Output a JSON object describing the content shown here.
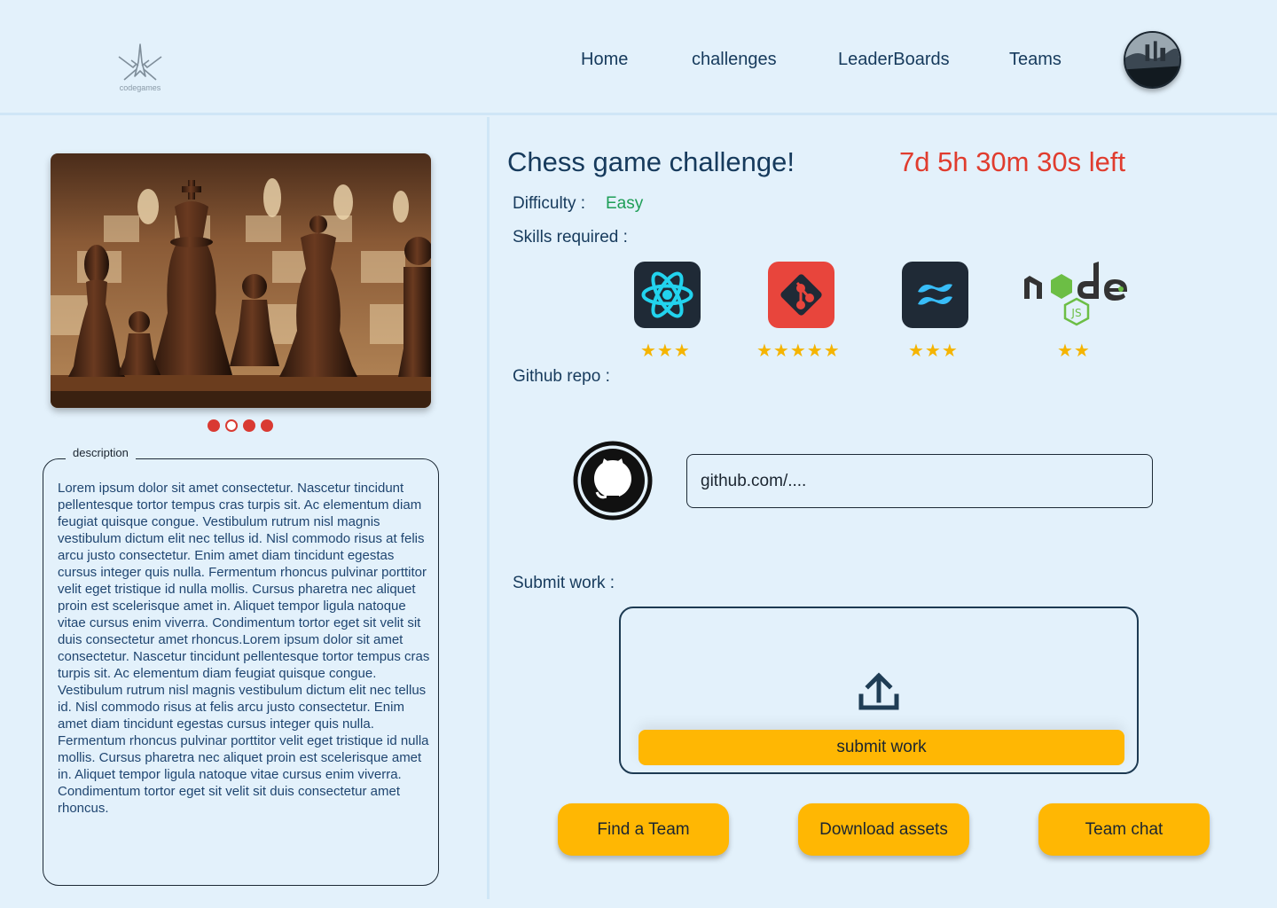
{
  "header": {
    "logo_text": "codegames",
    "nav": [
      {
        "label": "Home"
      },
      {
        "label": "challenges"
      },
      {
        "label": "LeaderBoards"
      },
      {
        "label": "Teams"
      }
    ]
  },
  "carousel": {
    "image_icon": "chess-pieces-photo",
    "dots": [
      {
        "state": "filled"
      },
      {
        "state": "hollow"
      },
      {
        "state": "filled"
      },
      {
        "state": "filled"
      }
    ]
  },
  "description": {
    "legend": "description",
    "text": "Lorem ipsum dolor sit amet consectetur. Nascetur tincidunt pellentesque tortor tempus cras turpis sit. Ac elementum diam feugiat quisque congue. Vestibulum rutrum nisl magnis vestibulum dictum elit nec tellus id. Nisl commodo risus at felis arcu justo consectetur. Enim amet diam tincidunt egestas cursus integer quis nulla. Fermentum rhoncus pulvinar porttitor velit eget tristique id nulla mollis. Cursus pharetra nec aliquet proin est scelerisque amet in. Aliquet tempor ligula natoque vitae cursus enim viverra. Condimentum tortor eget sit velit sit duis consectetur amet rhoncus.Lorem ipsum dolor sit amet consectetur. Nascetur tincidunt pellentesque tortor tempus cras turpis sit. Ac elementum diam feugiat quisque congue. Vestibulum rutrum nisl magnis vestibulum dictum elit nec tellus id. Nisl commodo risus at felis arcu justo consectetur. Enim amet diam tincidunt egestas cursus integer quis nulla. Fermentum rhoncus pulvinar porttitor velit eget tristique id nulla mollis. Cursus pharetra nec aliquet proin est scelerisque amet in. Aliquet tempor ligula natoque vitae cursus enim viverra. Condimentum tortor eget sit velit sit duis consectetur amet rhoncus."
  },
  "challenge": {
    "title": "Chess game challenge!",
    "timer": "7d 5h 30m 30s left",
    "difficulty_label": "Difficulty :",
    "difficulty_value": "Easy",
    "difficulty_color": "#1e9e57",
    "timer_color": "#e03c2e",
    "skills_label": "Skills required :",
    "skills": [
      {
        "name": "react-icon",
        "stars": "★★★",
        "rating": 3
      },
      {
        "name": "git-icon",
        "stars": "★★★★★",
        "rating": 5
      },
      {
        "name": "tailwind-icon",
        "stars": "★★★",
        "rating": 3
      },
      {
        "name": "nodejs-icon",
        "stars": "★★",
        "rating": 2
      }
    ],
    "repo_label": "Github repo :",
    "repo_placeholder": "github.com/....",
    "submit_label": "Submit work :",
    "submit_button": "submit work",
    "actions": {
      "find_team": "Find a Team",
      "download_assets": "Download assets",
      "team_chat": "Team chat"
    },
    "accent_color": "#ffb703"
  }
}
